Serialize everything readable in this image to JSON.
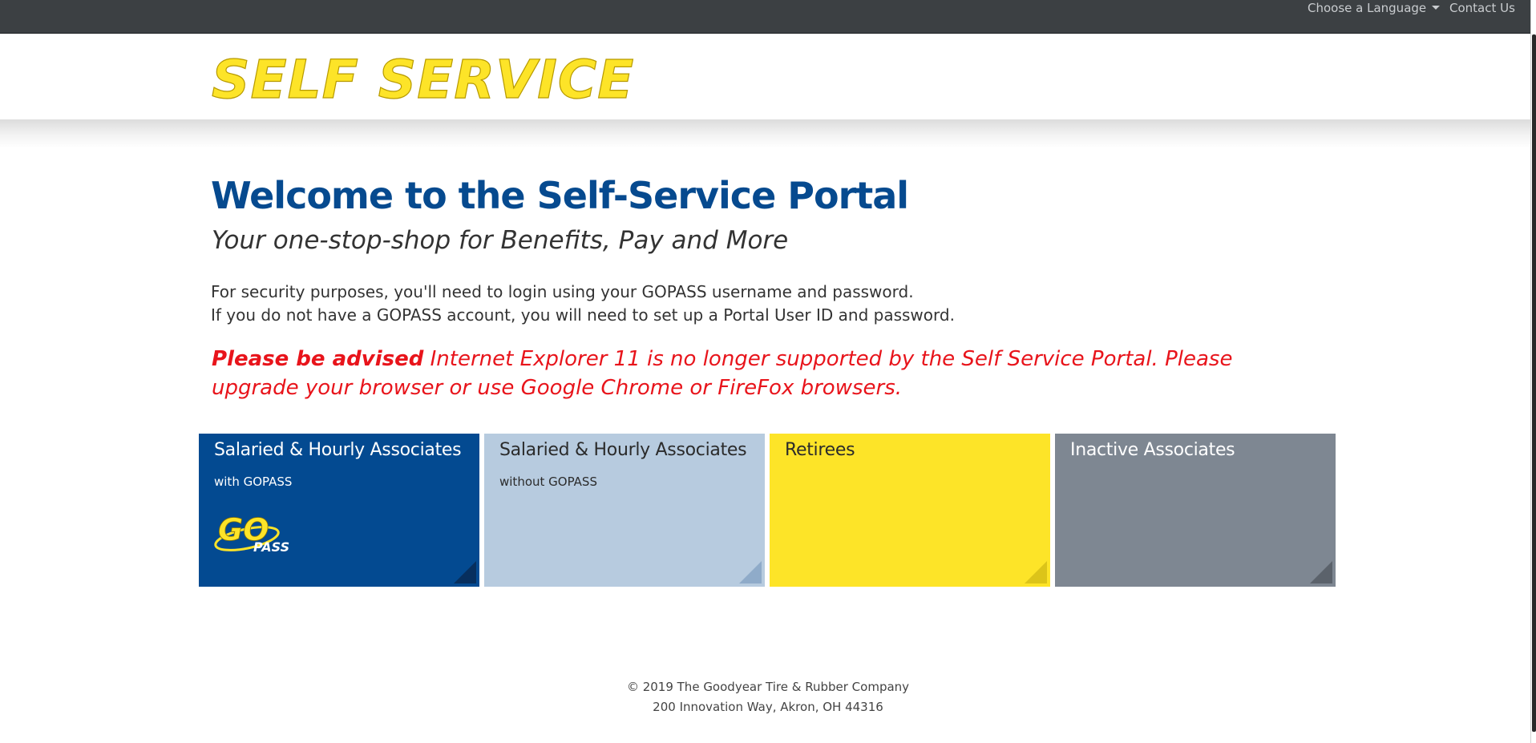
{
  "topnav": {
    "language_label": "Choose a Language",
    "contact_label": "Contact Us"
  },
  "header": {
    "logo_text": "SELF SERVICE",
    "logo_color": "#fde428"
  },
  "main": {
    "title": "Welcome to the Self-Service Portal",
    "subtitle": "Your one-stop-shop for Benefits, Pay and More",
    "intro_line1": "For security purposes, you'll need to login using your GOPASS username and password.",
    "intro_line2": "If you do not have a GOPASS account, you will need to set up a Portal User ID and password.",
    "notice_strong": "Please be advised",
    "notice_text": " Internet Explorer 11 is no longer supported by the Self Service Portal. Please upgrade your browser or use Google Chrome or FireFox browsers."
  },
  "tiles": [
    {
      "title": "Salaried & Hourly Associates",
      "subtitle": "with GOPASS",
      "color": "#034a91"
    },
    {
      "title": "Salaried & Hourly Associates",
      "subtitle": "without GOPASS",
      "color": "#b7cbdf"
    },
    {
      "title": "Retirees",
      "subtitle": "",
      "color": "#fde428"
    },
    {
      "title": "Inactive Associates",
      "subtitle": "",
      "color": "#7e8792"
    }
  ],
  "gopass_logo": {
    "text_go": "GO",
    "text_pass": "PASS"
  },
  "footer": {
    "copyright": "© 2019 The Goodyear Tire & Rubber Company",
    "address": "200 Innovation Way, Akron, OH 44316"
  },
  "colors": {
    "title_blue": "#064a8f",
    "notice_red": "#e8141b",
    "topbar_bg": "#3c4043"
  }
}
